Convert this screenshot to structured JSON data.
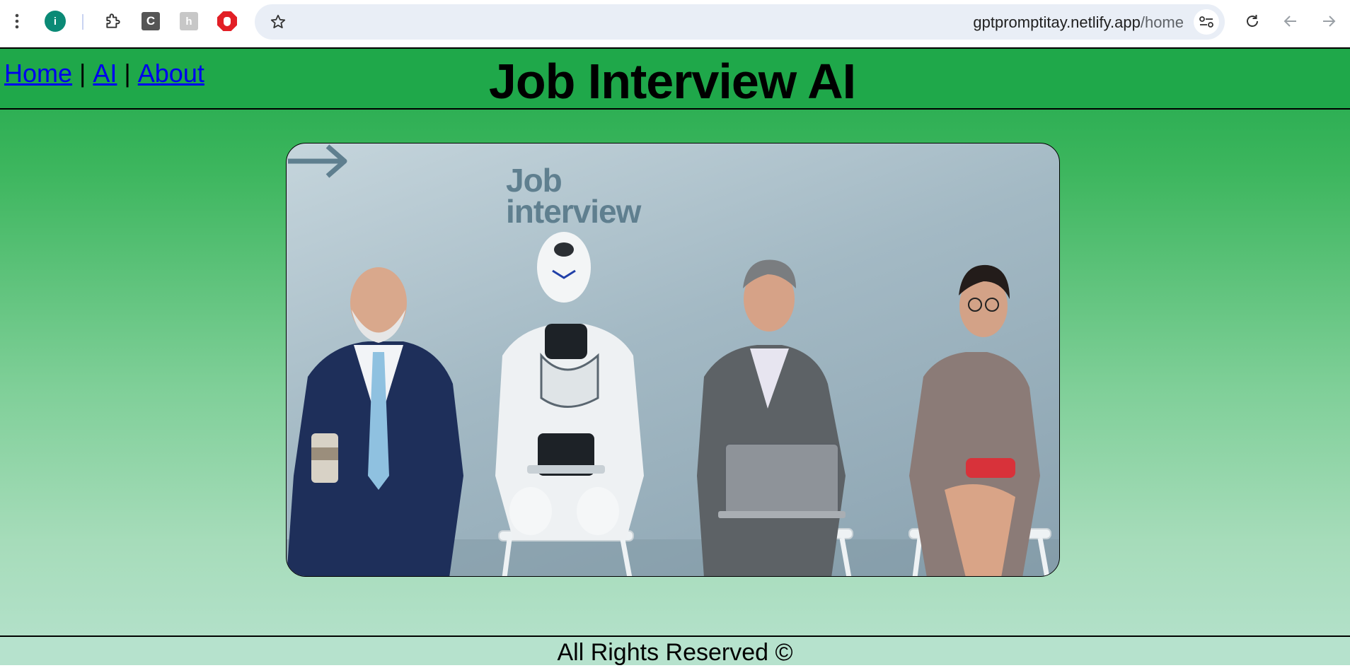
{
  "browser": {
    "url_domain": "gptpromptitay.netlify.app",
    "url_path": "/home",
    "extensions": [
      "i",
      "C",
      "h"
    ]
  },
  "nav": {
    "home": "Home",
    "ai": "AI",
    "about": "About",
    "separator": "|"
  },
  "header": {
    "title": "Job Interview AI"
  },
  "hero": {
    "heading_line1": "Job",
    "heading_line2": "interview"
  },
  "footer": {
    "text": "All Rights Reserved ©"
  },
  "colors": {
    "header_green": "#1fa84a",
    "link_blue": "#0000ee"
  }
}
